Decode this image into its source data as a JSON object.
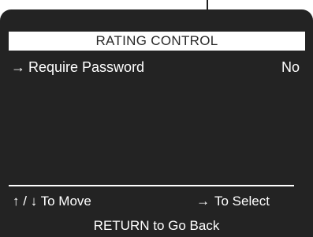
{
  "menu": {
    "title": "RATING CONTROL",
    "items": [
      {
        "pointer_glyph": "→",
        "pointer_icon": "right-arrow-icon",
        "label": "Require Password",
        "value": "No"
      }
    ]
  },
  "footer": {
    "move_up_glyph": "↑",
    "slash": "/",
    "move_down_glyph": "↓",
    "move_label": "To Move",
    "select_glyph": "→",
    "select_label": "To Select",
    "return_label": "RETURN to Go Back"
  },
  "colors": {
    "screen_background": "#232323",
    "text": "#ffffff",
    "title_bar_background": "#ffffff",
    "title_text": "#2a2a2a"
  }
}
